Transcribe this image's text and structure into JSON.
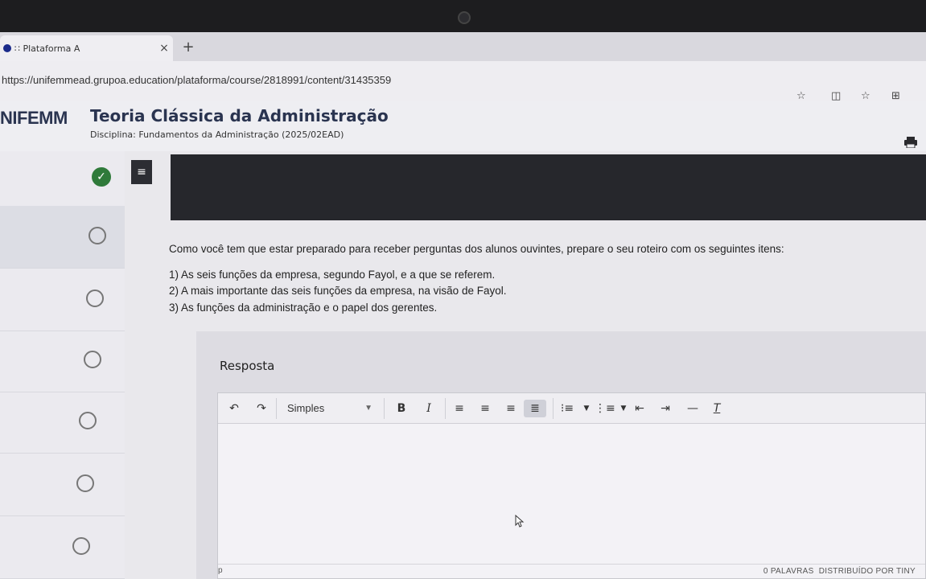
{
  "browser": {
    "tab_title": "∷ Plataforma A",
    "tab_close": "×",
    "new_tab": "+",
    "url": "https://unifemmead.grupoa.education/plataforma/course/2818991/content/31435359",
    "toolbar_icons": [
      "star-icon",
      "reader-icon",
      "favorites-icon",
      "collections-icon"
    ]
  },
  "header": {
    "logo": "NIFEMM",
    "title": "Teoria Clássica da Administração",
    "subtitle": "Disciplina: Fundamentos da Administração (2025/02EAD)"
  },
  "sidebar": {
    "items": [
      {
        "state": "completed"
      },
      {
        "state": "active"
      },
      {
        "state": "pending"
      },
      {
        "state": "pending"
      },
      {
        "state": "pending"
      },
      {
        "state": "pending"
      },
      {
        "state": "pending"
      }
    ]
  },
  "content": {
    "intro": "Como você tem que estar preparado para receber perguntas dos alunos ouvintes, prepare o seu roteiro com os seguintes itens:",
    "items": [
      "1) As seis funções da empresa, segundo Fayol, e a que se referem.",
      "2) A mais importante das seis funções da empresa, na visão de Fayol.",
      "3) As funções da administração e o papel dos gerentes."
    ]
  },
  "answer": {
    "label": "Resposta",
    "format_select": "Simples",
    "bold": "B",
    "italic": "I",
    "status_path": "p",
    "word_count": "0 PALAVRAS",
    "powered_by": "DISTRIBUÍDO POR TINY"
  },
  "colors": {
    "brand": "#2a3450",
    "completed": "#2f7a3a",
    "dark_bar": "#26272c"
  }
}
